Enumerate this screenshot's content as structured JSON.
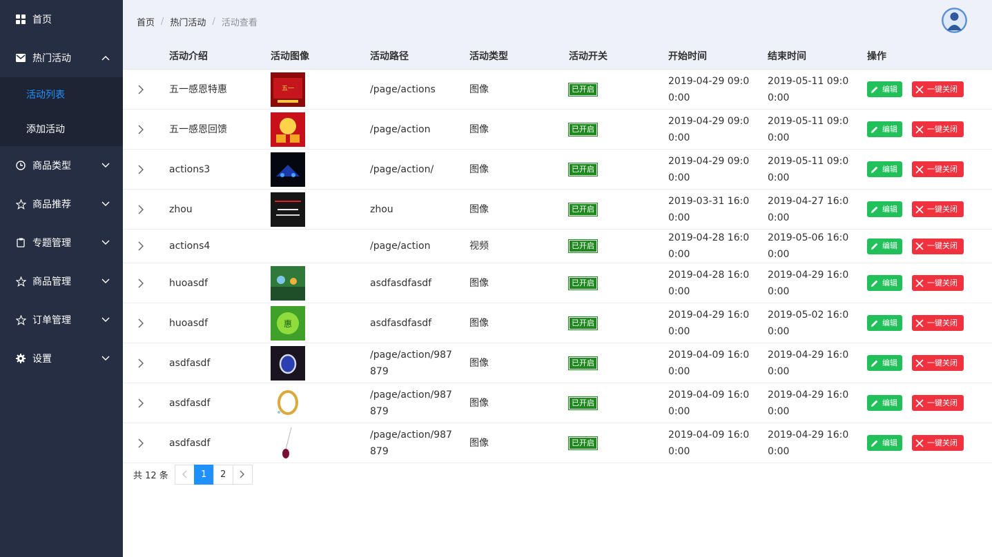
{
  "sidebar": {
    "items": [
      {
        "label": "首页",
        "icon": "dashboard-icon"
      },
      {
        "label": "热门活动",
        "icon": "envelope-icon",
        "expanded": true,
        "children": [
          {
            "label": "活动列表",
            "active": true
          },
          {
            "label": "添加活动"
          }
        ]
      },
      {
        "label": "商品类型",
        "icon": "clock-icon"
      },
      {
        "label": "商品推荐",
        "icon": "star-icon"
      },
      {
        "label": "专题管理",
        "icon": "clipboard-icon"
      },
      {
        "label": "商品管理",
        "icon": "star-icon"
      },
      {
        "label": "订单管理",
        "icon": "star-icon"
      },
      {
        "label": "设置",
        "icon": "gear-icon"
      }
    ]
  },
  "breadcrumb": [
    "首页",
    "热门活动",
    "活动查看"
  ],
  "table": {
    "headers": [
      "活动介绍",
      "活动图像",
      "活动路径",
      "活动类型",
      "活动开关",
      "开始时间",
      "结束时间",
      "操作"
    ],
    "rows": [
      {
        "intro": "五一感恩特惠",
        "image": "red-banner",
        "path": "/page/actions",
        "type": "图像",
        "switch": "已开启",
        "start": [
          "2019-04-29 09:0",
          "0:00"
        ],
        "end": [
          "2019-05-11 09:0",
          "0:00"
        ]
      },
      {
        "intro": "五一感恩回馈",
        "image": "red-gift",
        "path": "/page/action",
        "type": "图像",
        "switch": "已开启",
        "start": [
          "2019-04-29 09:0",
          "0:00"
        ],
        "end": [
          "2019-05-11 09:0",
          "0:00"
        ]
      },
      {
        "intro": "actions3",
        "image": "dark-blue",
        "path": "/page/action/",
        "type": "图像",
        "switch": "已开启",
        "start": [
          "2019-04-29 09:0",
          "0:00"
        ],
        "end": [
          "2019-05-11 09:0",
          "0:00"
        ]
      },
      {
        "intro": "zhou",
        "image": "black-text",
        "path": "zhou",
        "type": "图像",
        "switch": "已开启",
        "start": [
          "2019-03-31 16:0",
          "0:00"
        ],
        "end": [
          "2019-04-27 16:0",
          "0:00"
        ]
      },
      {
        "intro": "actions4",
        "image": "",
        "path": "/page/action",
        "type": "视频",
        "switch": "已开启",
        "start": [
          "2019-04-28 16:0",
          "0:00"
        ],
        "end": [
          "2019-05-06 16:0",
          "0:00"
        ]
      },
      {
        "intro": "huoasdf",
        "image": "green-photo",
        "path": "asdfasdfasdf",
        "type": "图像",
        "switch": "已开启",
        "start": [
          "2019-04-28 16:0",
          "0:00"
        ],
        "end": [
          "2019-04-29 16:0",
          "0:00"
        ]
      },
      {
        "intro": "huoasdf",
        "image": "green-banner",
        "path": "asdfasdfasdf",
        "type": "图像",
        "switch": "已开启",
        "start": [
          "2019-04-29 16:0",
          "0:00"
        ],
        "end": [
          "2019-05-02 16:0",
          "0:00"
        ]
      },
      {
        "intro": "asdfasdf",
        "image": "sapphire-ring",
        "path": [
          "/page/action/987",
          "879"
        ],
        "type": "图像",
        "switch": "已开启",
        "start": [
          "2019-04-09 16:0",
          "0:00"
        ],
        "end": [
          "2019-04-29 16:0",
          "0:00"
        ]
      },
      {
        "intro": "asdfasdf",
        "image": "gold-ring",
        "path": [
          "/page/action/987",
          "879"
        ],
        "type": "图像",
        "switch": "已开启",
        "start": [
          "2019-04-09 16:0",
          "0:00"
        ],
        "end": [
          "2019-04-29 16:0",
          "0:00"
        ]
      },
      {
        "intro": "asdfasdf",
        "image": "pendant",
        "path": [
          "/page/action/987",
          "879"
        ],
        "type": "图像",
        "switch": "已开启",
        "start": [
          "2019-04-09 16:0",
          "0:00"
        ],
        "end": [
          "2019-04-29 16:0",
          "0:00"
        ]
      }
    ],
    "edit_label": "编辑",
    "close_label": "一键关闭"
  },
  "pagination": {
    "total": "共 12 条",
    "pages": [
      "1",
      "2"
    ],
    "current": "1"
  },
  "colors": {
    "sidebar_bg": "#252e43",
    "accent": "#1e90ff",
    "edit": "#21c05b",
    "close": "#f0313e",
    "badge": "#1e8a1e"
  }
}
